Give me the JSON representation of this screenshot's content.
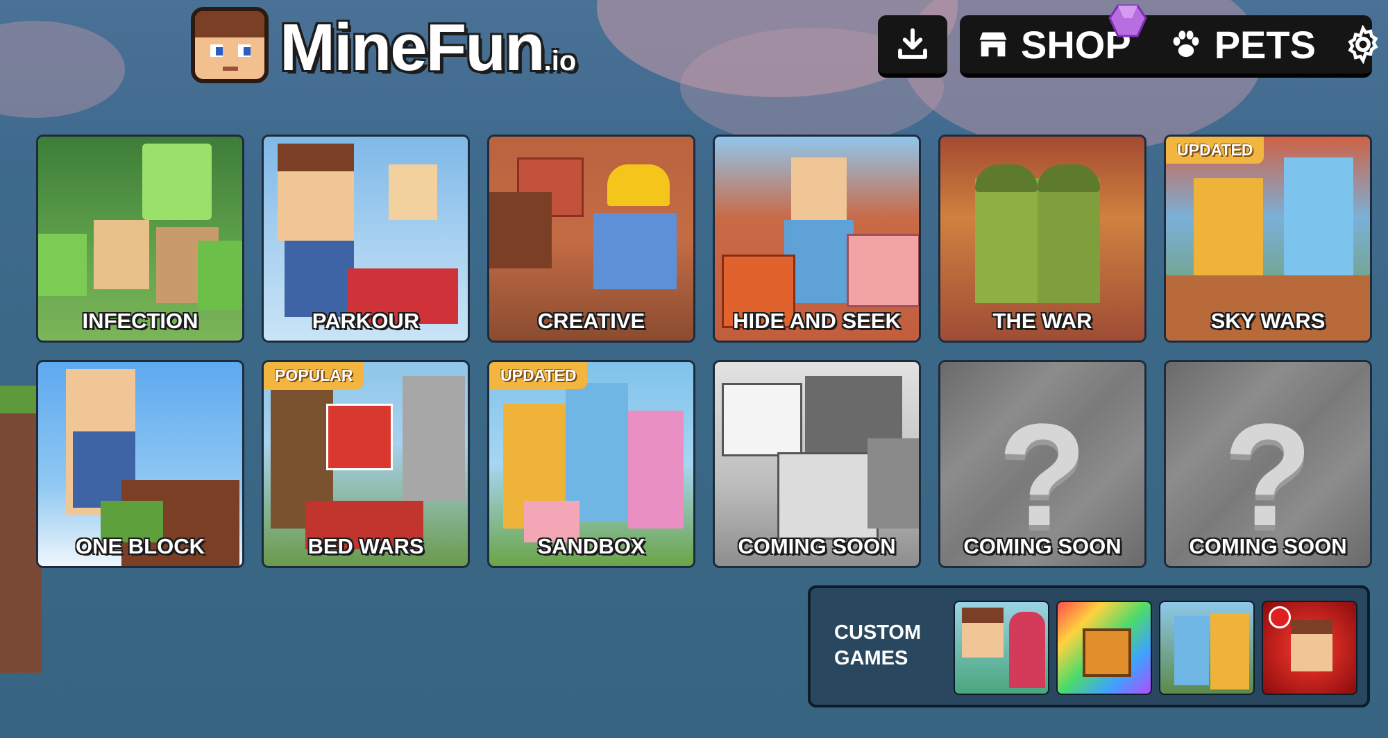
{
  "app": {
    "logo_text": "MineFun",
    "logo_suffix": ".io"
  },
  "header": {
    "download_icon": "download-icon",
    "shop_label": "SHOP",
    "shop_icon": "store-icon",
    "pets_label": "PETS",
    "pets_icon": "paw-icon",
    "settings_icon": "gear-icon",
    "gem_icon": "gem-icon"
  },
  "games": [
    {
      "label": "INFECTION",
      "badge": ""
    },
    {
      "label": "PARKOUR",
      "badge": ""
    },
    {
      "label": "CREATIVE",
      "badge": ""
    },
    {
      "label": "HIDE AND SEEK",
      "badge": ""
    },
    {
      "label": "THE WAR",
      "badge": ""
    },
    {
      "label": "SKY WARS",
      "badge": "UPDATED"
    },
    {
      "label": "ONE BLOCK",
      "badge": ""
    },
    {
      "label": "BED WARS",
      "badge": "POPULAR"
    },
    {
      "label": "SANDBOX",
      "badge": "UPDATED"
    },
    {
      "label": "COMING SOON",
      "badge": ""
    },
    {
      "label": "COMING SOON",
      "badge": ""
    },
    {
      "label": "COMING SOON",
      "badge": ""
    }
  ],
  "coming_soon_glyph": "?",
  "custom_games": {
    "title": "CUSTOM GAMES"
  },
  "colors": {
    "badge": "#f2b53f",
    "topbar": "#151515",
    "background": "#3b6886",
    "panel": "#29485f"
  }
}
